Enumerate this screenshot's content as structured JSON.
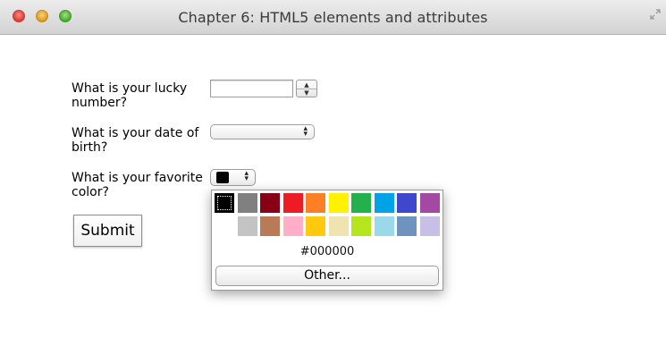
{
  "window": {
    "title": "Chapter 6: HTML5 elements and attributes"
  },
  "form": {
    "lucky_label": "What is your lucky number?",
    "lucky_value": "",
    "dob_label": "What is your date of birth?",
    "dob_value": "",
    "color_label": "What is your favorite color?",
    "color_value": "#000000",
    "submit_label": "Submit"
  },
  "color_picker": {
    "row1": [
      "#000000",
      "#808080",
      "#880015",
      "#ed1c24",
      "#ff7f27",
      "#fff200",
      "#22b14c",
      "#00a2e8",
      "#3f48cc",
      "#a349a4"
    ],
    "row2": [
      "#ffffff",
      "#c3c3c3",
      "#b97a57",
      "#ffaec9",
      "#ffc90e",
      "#efe4b0",
      "#b5e61d",
      "#99d9ea",
      "#7092be",
      "#c8bfe7"
    ],
    "selected": "#000000",
    "hex_readout": "#000000",
    "other_label": "Other..."
  },
  "icons": {
    "close": "close-icon",
    "minimize": "minimize-icon",
    "zoom": "zoom-icon",
    "fullscreen": "fullscreen-icon"
  }
}
